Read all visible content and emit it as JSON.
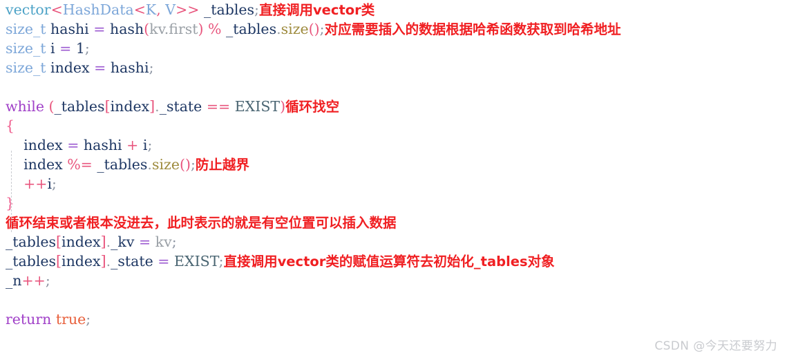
{
  "document": {
    "type": "code-snippet-screenshot",
    "language": "C++",
    "background_color": "#ffffff"
  },
  "colors": {
    "annotation_red": "#f01f22",
    "keyword_purple": "#a040c8",
    "punctuation_pink": "#e8547c",
    "type_blue": "#7da7d9",
    "identifier_navy": "#1f3864",
    "gray": "#9aa0a6",
    "function_olive": "#9e8b3e",
    "enum_slate": "#4a6572",
    "constant_orange": "#e8603c",
    "watermark_gray": "#c9cbcf"
  },
  "lines": [
    {
      "id": "line-1",
      "indent": 0,
      "tokens": [
        {
          "text": "vector",
          "cls": "t-vector"
        },
        {
          "text": "<",
          "cls": "t-punct"
        },
        {
          "text": "HashData",
          "cls": "t-type"
        },
        {
          "text": "<",
          "cls": "t-punct"
        },
        {
          "text": "K",
          "cls": "t-type"
        },
        {
          "text": ",",
          "cls": "t-punct"
        },
        {
          "text": " ",
          "cls": "t-ident"
        },
        {
          "text": "V",
          "cls": "t-type"
        },
        {
          "text": ">>",
          "cls": "t-punct"
        },
        {
          "text": " ",
          "cls": "t-ident"
        },
        {
          "text": "_tables",
          "cls": "t-ident"
        },
        {
          "text": ";",
          "cls": "t-semi"
        }
      ],
      "annotation": "直接调用vector类"
    },
    {
      "id": "line-2",
      "indent": 0,
      "tokens": [
        {
          "text": "size_t",
          "cls": "t-type"
        },
        {
          "text": " ",
          "cls": "t-ident"
        },
        {
          "text": "hashi",
          "cls": "t-ident"
        },
        {
          "text": " ",
          "cls": "t-ident"
        },
        {
          "text": "=",
          "cls": "t-op"
        },
        {
          "text": " ",
          "cls": "t-ident"
        },
        {
          "text": "hash",
          "cls": "t-ident"
        },
        {
          "text": "(",
          "cls": "t-punct"
        },
        {
          "text": "kv",
          "cls": "t-gray"
        },
        {
          "text": ".",
          "cls": "t-gray"
        },
        {
          "text": "first",
          "cls": "t-gray"
        },
        {
          "text": ")",
          "cls": "t-punct"
        },
        {
          "text": " ",
          "cls": "t-ident"
        },
        {
          "text": "%",
          "cls": "t-punct"
        },
        {
          "text": " ",
          "cls": "t-ident"
        },
        {
          "text": "_tables",
          "cls": "t-ident"
        },
        {
          "text": ".",
          "cls": "t-gray"
        },
        {
          "text": "size",
          "cls": "t-func"
        },
        {
          "text": "()",
          "cls": "t-punct"
        },
        {
          "text": ";",
          "cls": "t-semi"
        }
      ],
      "annotation": "对应需要插入的数据根据哈希函数获取到哈希地址"
    },
    {
      "id": "line-3",
      "indent": 0,
      "tokens": [
        {
          "text": "size_t",
          "cls": "t-type"
        },
        {
          "text": " ",
          "cls": "t-ident"
        },
        {
          "text": "i",
          "cls": "t-ident"
        },
        {
          "text": " ",
          "cls": "t-ident"
        },
        {
          "text": "=",
          "cls": "t-op"
        },
        {
          "text": " ",
          "cls": "t-ident"
        },
        {
          "text": "1",
          "cls": "t-ident"
        },
        {
          "text": ";",
          "cls": "t-semi"
        }
      ],
      "annotation": ""
    },
    {
      "id": "line-4",
      "indent": 0,
      "tokens": [
        {
          "text": "size_t",
          "cls": "t-type"
        },
        {
          "text": " ",
          "cls": "t-ident"
        },
        {
          "text": "index",
          "cls": "t-ident"
        },
        {
          "text": " ",
          "cls": "t-ident"
        },
        {
          "text": "=",
          "cls": "t-op"
        },
        {
          "text": " ",
          "cls": "t-ident"
        },
        {
          "text": "hashi",
          "cls": "t-ident"
        },
        {
          "text": ";",
          "cls": "t-semi"
        }
      ],
      "annotation": ""
    },
    {
      "id": "line-5",
      "indent": 0,
      "tokens": [],
      "annotation": ""
    },
    {
      "id": "line-6",
      "indent": 0,
      "tokens": [
        {
          "text": "while",
          "cls": "t-kw"
        },
        {
          "text": " ",
          "cls": "t-ident"
        },
        {
          "text": "(",
          "cls": "t-punct"
        },
        {
          "text": "_tables",
          "cls": "t-ident"
        },
        {
          "text": "[",
          "cls": "t-punct"
        },
        {
          "text": "index",
          "cls": "t-ident"
        },
        {
          "text": "]",
          "cls": "t-punct"
        },
        {
          "text": ".",
          "cls": "t-gray"
        },
        {
          "text": "_state",
          "cls": "t-ident"
        },
        {
          "text": " ",
          "cls": "t-ident"
        },
        {
          "text": "==",
          "cls": "t-punct"
        },
        {
          "text": " ",
          "cls": "t-ident"
        },
        {
          "text": "EXIST",
          "cls": "t-enum"
        },
        {
          "text": ")",
          "cls": "t-punct"
        }
      ],
      "annotation": "循环找空"
    },
    {
      "id": "line-7",
      "indent": 0,
      "tokens": [
        {
          "text": "{",
          "cls": "t-brace"
        }
      ],
      "annotation": ""
    },
    {
      "id": "line-8",
      "indent": 1,
      "tokens": [
        {
          "text": "index",
          "cls": "t-ident"
        },
        {
          "text": " ",
          "cls": "t-ident"
        },
        {
          "text": "=",
          "cls": "t-op"
        },
        {
          "text": " ",
          "cls": "t-ident"
        },
        {
          "text": "hashi",
          "cls": "t-ident"
        },
        {
          "text": " ",
          "cls": "t-ident"
        },
        {
          "text": "+",
          "cls": "t-punct"
        },
        {
          "text": " ",
          "cls": "t-ident"
        },
        {
          "text": "i",
          "cls": "t-ident"
        },
        {
          "text": ";",
          "cls": "t-semi"
        }
      ],
      "annotation": ""
    },
    {
      "id": "line-9",
      "indent": 1,
      "tokens": [
        {
          "text": "index",
          "cls": "t-ident"
        },
        {
          "text": " ",
          "cls": "t-ident"
        },
        {
          "text": "%=",
          "cls": "t-punct"
        },
        {
          "text": " ",
          "cls": "t-ident"
        },
        {
          "text": "_tables",
          "cls": "t-ident"
        },
        {
          "text": ".",
          "cls": "t-gray"
        },
        {
          "text": "size",
          "cls": "t-func"
        },
        {
          "text": "()",
          "cls": "t-punct"
        },
        {
          "text": ";",
          "cls": "t-semi"
        }
      ],
      "annotation": "防止越界"
    },
    {
      "id": "line-10",
      "indent": 1,
      "tokens": [
        {
          "text": "++",
          "cls": "t-punct"
        },
        {
          "text": "i",
          "cls": "t-ident"
        },
        {
          "text": ";",
          "cls": "t-semi"
        }
      ],
      "annotation": ""
    },
    {
      "id": "line-11",
      "indent": 0,
      "tokens": [
        {
          "text": "}",
          "cls": "t-brace"
        }
      ],
      "annotation": ""
    },
    {
      "id": "line-12",
      "indent": 0,
      "tokens": [],
      "annotation": "循环结束或者根本没进去，此时表示的就是有空位置可以插入数据"
    },
    {
      "id": "line-13",
      "indent": 0,
      "tokens": [
        {
          "text": "_tables",
          "cls": "t-ident"
        },
        {
          "text": "[",
          "cls": "t-punct"
        },
        {
          "text": "index",
          "cls": "t-ident"
        },
        {
          "text": "]",
          "cls": "t-punct"
        },
        {
          "text": ".",
          "cls": "t-gray"
        },
        {
          "text": "_kv",
          "cls": "t-ident"
        },
        {
          "text": " ",
          "cls": "t-ident"
        },
        {
          "text": "=",
          "cls": "t-op"
        },
        {
          "text": " ",
          "cls": "t-ident"
        },
        {
          "text": "kv",
          "cls": "t-gray"
        },
        {
          "text": ";",
          "cls": "t-semi"
        }
      ],
      "annotation": ""
    },
    {
      "id": "line-14",
      "indent": 0,
      "tokens": [
        {
          "text": "_tables",
          "cls": "t-ident"
        },
        {
          "text": "[",
          "cls": "t-punct"
        },
        {
          "text": "index",
          "cls": "t-ident"
        },
        {
          "text": "]",
          "cls": "t-punct"
        },
        {
          "text": ".",
          "cls": "t-gray"
        },
        {
          "text": "_state",
          "cls": "t-ident"
        },
        {
          "text": " ",
          "cls": "t-ident"
        },
        {
          "text": "=",
          "cls": "t-op"
        },
        {
          "text": " ",
          "cls": "t-ident"
        },
        {
          "text": "EXIST",
          "cls": "t-enum"
        },
        {
          "text": ";",
          "cls": "t-semi"
        }
      ],
      "annotation": "直接调用vector类的赋值运算符去初始化_tables对象"
    },
    {
      "id": "line-15",
      "indent": 0,
      "tokens": [
        {
          "text": "_n",
          "cls": "t-ident"
        },
        {
          "text": "++",
          "cls": "t-punct"
        },
        {
          "text": ";",
          "cls": "t-semi"
        }
      ],
      "annotation": ""
    },
    {
      "id": "line-16",
      "indent": 0,
      "tokens": [],
      "annotation": ""
    },
    {
      "id": "line-17",
      "indent": 0,
      "tokens": [
        {
          "text": "return",
          "cls": "t-kw"
        },
        {
          "text": " ",
          "cls": "t-ident"
        },
        {
          "text": "true",
          "cls": "t-const"
        },
        {
          "text": ";",
          "cls": "t-semi"
        }
      ],
      "annotation": ""
    }
  ],
  "watermark": {
    "text": "CSDN @今天还要努力"
  }
}
